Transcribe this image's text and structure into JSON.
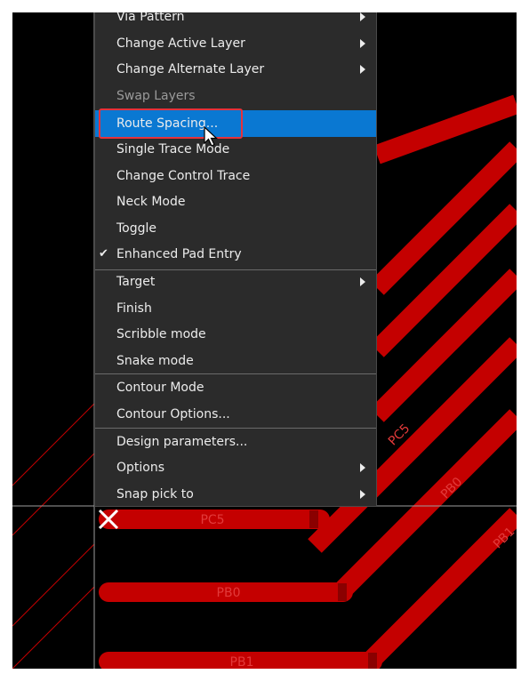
{
  "colors": {
    "canvas_bg": "#000000",
    "trace": "#c40000",
    "trace_label": "#e23a3a",
    "crosshair": "#9e9e9e",
    "menu_bg": "#2b2b2b",
    "menu_text": "#ececec",
    "menu_disabled": "#9a9a9a",
    "highlight": "#0a78d2",
    "annotation": "#e6313a"
  },
  "pcb": {
    "net_labels": [
      "PC5",
      "PB0",
      "PB1",
      "PC5",
      "PB0",
      "PB1"
    ]
  },
  "context_menu": {
    "items": [
      {
        "label": "Via Pattern",
        "submenu": true
      },
      {
        "label": "Change Active Layer",
        "submenu": true
      },
      {
        "label": "Change Alternate Layer",
        "submenu": true
      },
      {
        "label": "Swap Layers",
        "disabled": true
      },
      {
        "label": "Route Spacing...",
        "highlighted": true
      },
      {
        "label": "Single Trace Mode"
      },
      {
        "label": "Change Control Trace"
      },
      {
        "label": "Neck Mode"
      },
      {
        "label": "Toggle"
      },
      {
        "label": "Enhanced Pad Entry",
        "checked": true
      },
      {
        "label": "Target",
        "submenu": true
      },
      {
        "label": "Finish"
      },
      {
        "label": "Scribble mode"
      },
      {
        "label": "Snake mode"
      },
      {
        "label": "Contour Mode"
      },
      {
        "label": "Contour Options..."
      },
      {
        "label": "Design parameters..."
      },
      {
        "label": "Options",
        "submenu": true
      },
      {
        "label": "Snap pick to",
        "submenu": true
      }
    ],
    "check_glyph": "✔"
  },
  "icons": {
    "cross_marker": "x-marker-icon",
    "pointer": "mouse-pointer-icon",
    "submenu_arrow": "chevron-right-icon",
    "check": "check-icon"
  }
}
